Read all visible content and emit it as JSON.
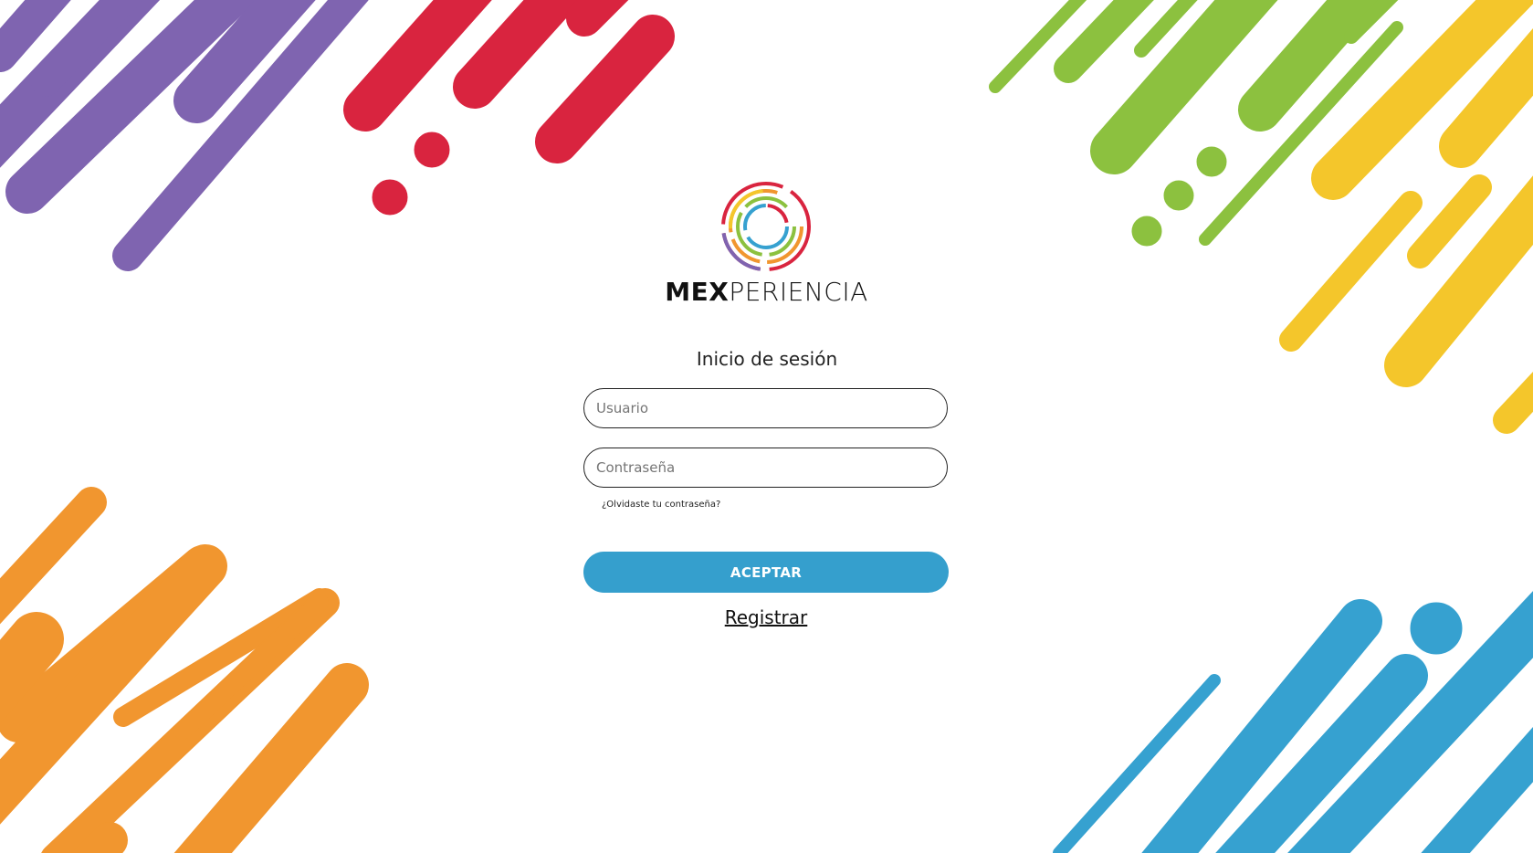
{
  "brand": {
    "name_bold": "MEX",
    "name_light": "PERIENCIA",
    "ring_colors": [
      "#d9243f",
      "#f1962f",
      "#f4c62b",
      "#8cc13f",
      "#36a1d0",
      "#7f64b0"
    ]
  },
  "login": {
    "title": "Inicio de sesión",
    "username_placeholder": "Usuario",
    "password_placeholder": "Contraseña",
    "username_value": "",
    "password_value": "",
    "forgot_link": "¿Olvidaste tu contraseña?",
    "submit_label": "ACEPTAR",
    "register_link": "Registrar"
  },
  "colors": {
    "purple": "#7f64b0",
    "red": "#d9243f",
    "green": "#8cc13f",
    "yellow": "#f4c62b",
    "orange": "#f1962f",
    "blue": "#36a1d0",
    "accept_button": "#359fcd"
  }
}
